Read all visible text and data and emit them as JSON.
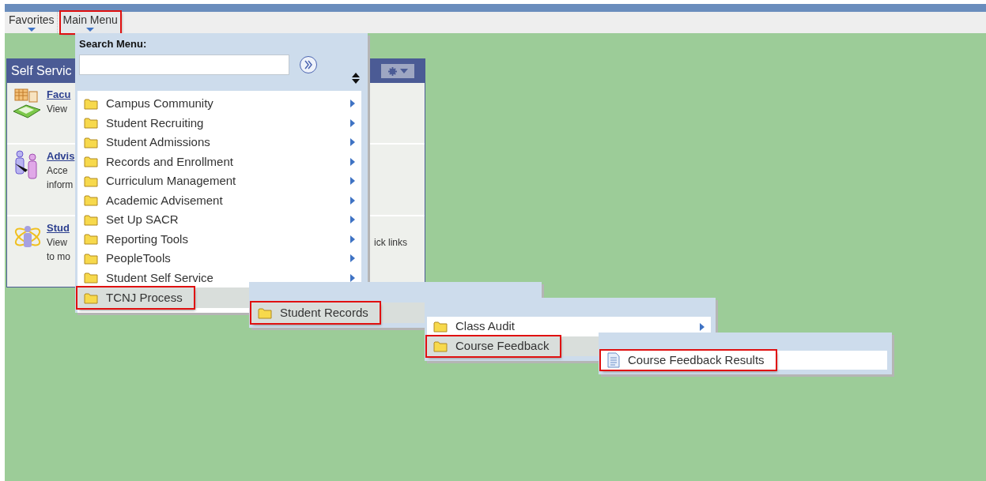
{
  "menu_bar": {
    "items": [
      {
        "label": "Favorites",
        "selected": false
      },
      {
        "label": "Main Menu",
        "selected": true
      }
    ]
  },
  "portlet": {
    "title": "Self Servic",
    "items": [
      {
        "title": "Facu",
        "lines": [
          "View"
        ]
      },
      {
        "title": "Advis",
        "lines": [
          "Acce",
          "inform"
        ]
      },
      {
        "title": "Stud",
        "lines": [
          "View",
          "to mo"
        ],
        "line_end": "ick links"
      }
    ]
  },
  "main_menu": {
    "search_label": "Search Menu:",
    "items": [
      {
        "label": "Campus Community",
        "kind": "folder",
        "selected": false
      },
      {
        "label": "Student Recruiting",
        "kind": "folder",
        "selected": false
      },
      {
        "label": "Student Admissions",
        "kind": "folder",
        "selected": false
      },
      {
        "label": "Records and Enrollment",
        "kind": "folder",
        "selected": false
      },
      {
        "label": "Curriculum Management",
        "kind": "folder",
        "selected": false
      },
      {
        "label": "Academic Advisement",
        "kind": "folder",
        "selected": false
      },
      {
        "label": "Set Up SACR",
        "kind": "folder",
        "selected": false
      },
      {
        "label": "Reporting Tools",
        "kind": "folder",
        "selected": false
      },
      {
        "label": "PeopleTools",
        "kind": "folder",
        "selected": false
      },
      {
        "label": "Student Self Service",
        "kind": "folder",
        "selected": false
      },
      {
        "label": "TCNJ Process",
        "kind": "folder",
        "selected": true
      }
    ]
  },
  "submenus": [
    {
      "items": [
        {
          "label": "Student Records",
          "kind": "folder",
          "selected": true
        }
      ]
    },
    {
      "items": [
        {
          "label": "Class Audit",
          "kind": "folder",
          "selected": false
        },
        {
          "label": "Course Feedback",
          "kind": "folder",
          "selected": true
        }
      ]
    },
    {
      "items": [
        {
          "label": "Course Feedback Results",
          "kind": "page",
          "selected": true
        }
      ]
    }
  ]
}
